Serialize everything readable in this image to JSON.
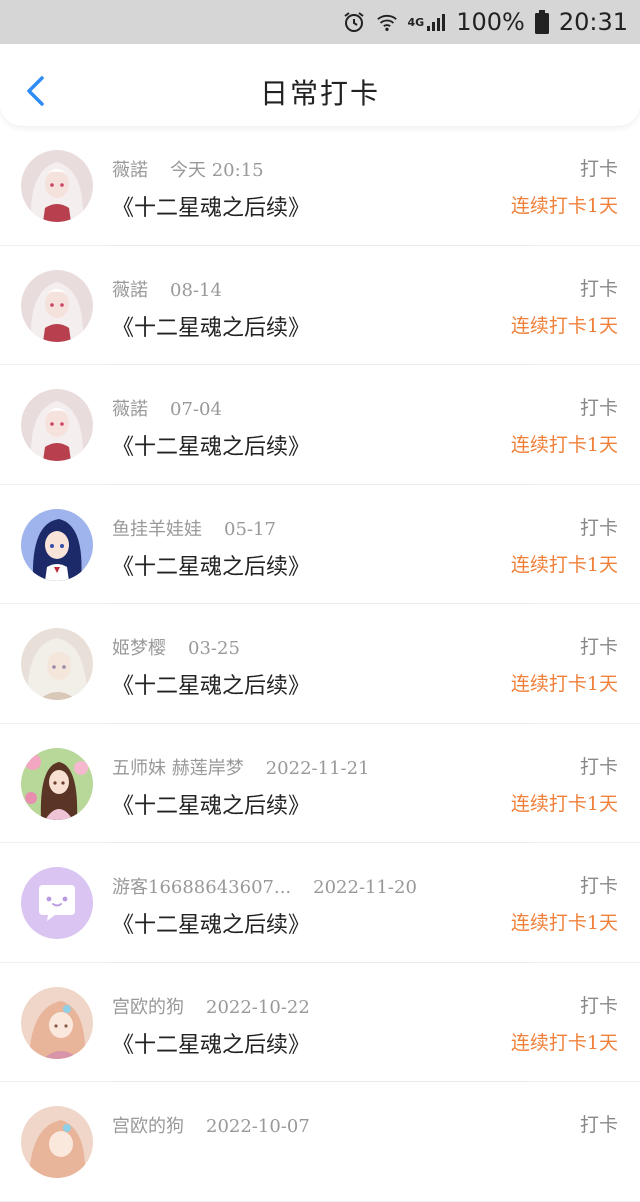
{
  "status": {
    "battery_pct": "100%",
    "time": "20:31",
    "network": "4G"
  },
  "header": {
    "title": "日常打卡"
  },
  "rows": [
    {
      "name": "薇諾",
      "date": "今天 20:15",
      "book": "《十二星魂之后续》",
      "action": "打卡",
      "streak": "连续打卡1天",
      "avatar": "white-hair"
    },
    {
      "name": "薇諾",
      "date": "08-14",
      "book": "《十二星魂之后续》",
      "action": "打卡",
      "streak": "连续打卡1天",
      "avatar": "white-hair"
    },
    {
      "name": "薇諾",
      "date": "07-04",
      "book": "《十二星魂之后续》",
      "action": "打卡",
      "streak": "连续打卡1天",
      "avatar": "white-hair"
    },
    {
      "name": "鱼挂羊娃娃",
      "date": "05-17",
      "book": "《十二星魂之后续》",
      "action": "打卡",
      "streak": "连续打卡1天",
      "avatar": "blue-hair"
    },
    {
      "name": "姬梦樱",
      "date": "03-25",
      "book": "《十二星魂之后续》",
      "action": "打卡",
      "streak": "连续打卡1天",
      "avatar": "silver-hair"
    },
    {
      "name": "五师妹 赫莲岸梦",
      "date": "2022-11-21",
      "book": "《十二星魂之后续》",
      "action": "打卡",
      "streak": "连续打卡1天",
      "avatar": "flower-girl"
    },
    {
      "name": "游客16688643607...",
      "date": "2022-11-20",
      "book": "《十二星魂之后续》",
      "action": "打卡",
      "streak": "连续打卡1天",
      "avatar": "default-chat"
    },
    {
      "name": "宫欧的狗",
      "date": "2022-10-22",
      "book": "《十二星魂之后续》",
      "action": "打卡",
      "streak": "连续打卡1天",
      "avatar": "pink-hair"
    },
    {
      "name": "宫欧的狗",
      "date": "2022-10-07",
      "book": "",
      "action": "打卡",
      "streak": "",
      "avatar": "pink-hair"
    }
  ],
  "colors": {
    "accent": "#2f8cf5",
    "streak": "#f0813a",
    "statusbar": "#d6d6d6"
  }
}
